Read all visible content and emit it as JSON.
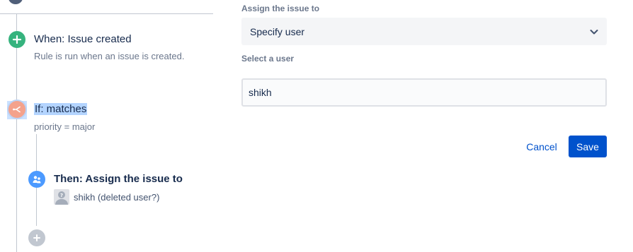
{
  "rule": {
    "trigger": {
      "title": "When: Issue created",
      "description": "Rule is run when an issue is created.",
      "icon": "plus-icon",
      "color": "#36b37e"
    },
    "condition": {
      "title": "If: matches",
      "description": "priority = major",
      "icon": "branch-icon",
      "color": "#f4a28c"
    },
    "action": {
      "title": "Then: Assign the issue to",
      "assignee": "shikh (deleted user?)",
      "icon": "assign-user-icon",
      "color": "#4c9aff"
    },
    "add_component": {
      "icon": "add-icon"
    }
  },
  "config": {
    "assign_label": "Assign the issue to",
    "assign_value": "Specify user",
    "user_label": "Select a user",
    "user_value": "shikh",
    "cancel_label": "Cancel",
    "save_label": "Save"
  },
  "colors": {
    "primary": "#0052cc",
    "selection": "#b3d4ff",
    "muted_text": "#6b778c"
  }
}
